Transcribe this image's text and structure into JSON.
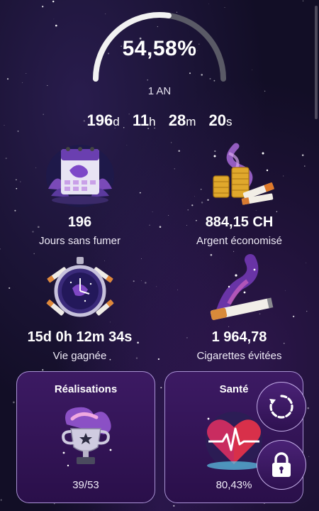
{
  "progress": {
    "percent_text": "54,58%",
    "fraction": 0.5458,
    "goal_label": "1 AN"
  },
  "timer": {
    "days": "196",
    "days_unit": "d",
    "hours": "11",
    "hours_unit": "h",
    "minutes": "28",
    "minutes_unit": "m",
    "seconds": "20",
    "seconds_unit": "s"
  },
  "stats": {
    "days_smoke_free": {
      "value": "196",
      "label": "Jours sans fumer",
      "icon": "calendar-illustration"
    },
    "money_saved": {
      "value": "884,15 CH",
      "label": "Argent économisé",
      "icon": "coins-illustration"
    },
    "life_gained": {
      "value": "15d 0h 12m 34s",
      "label": "Vie gagnée",
      "icon": "stopwatch-illustration"
    },
    "cigarettes_avoided": {
      "value": "1 964,78",
      "label": "Cigarettes évitées",
      "icon": "cigarette-illustration"
    }
  },
  "cards": {
    "achievements": {
      "title": "Réalisations",
      "value": "39/53",
      "icon": "trophy-illustration"
    },
    "health": {
      "title": "Santé",
      "value": "80,43%",
      "icon": "heart-illustration"
    }
  },
  "buttons": {
    "reset_icon": "reset-icon",
    "lock_icon": "lock-icon"
  },
  "colors": {
    "arc_fill": "#f2f2f2",
    "arc_track": "#5a5a66",
    "card_border": "#d2beff",
    "card_bg": "#3c1a63"
  }
}
